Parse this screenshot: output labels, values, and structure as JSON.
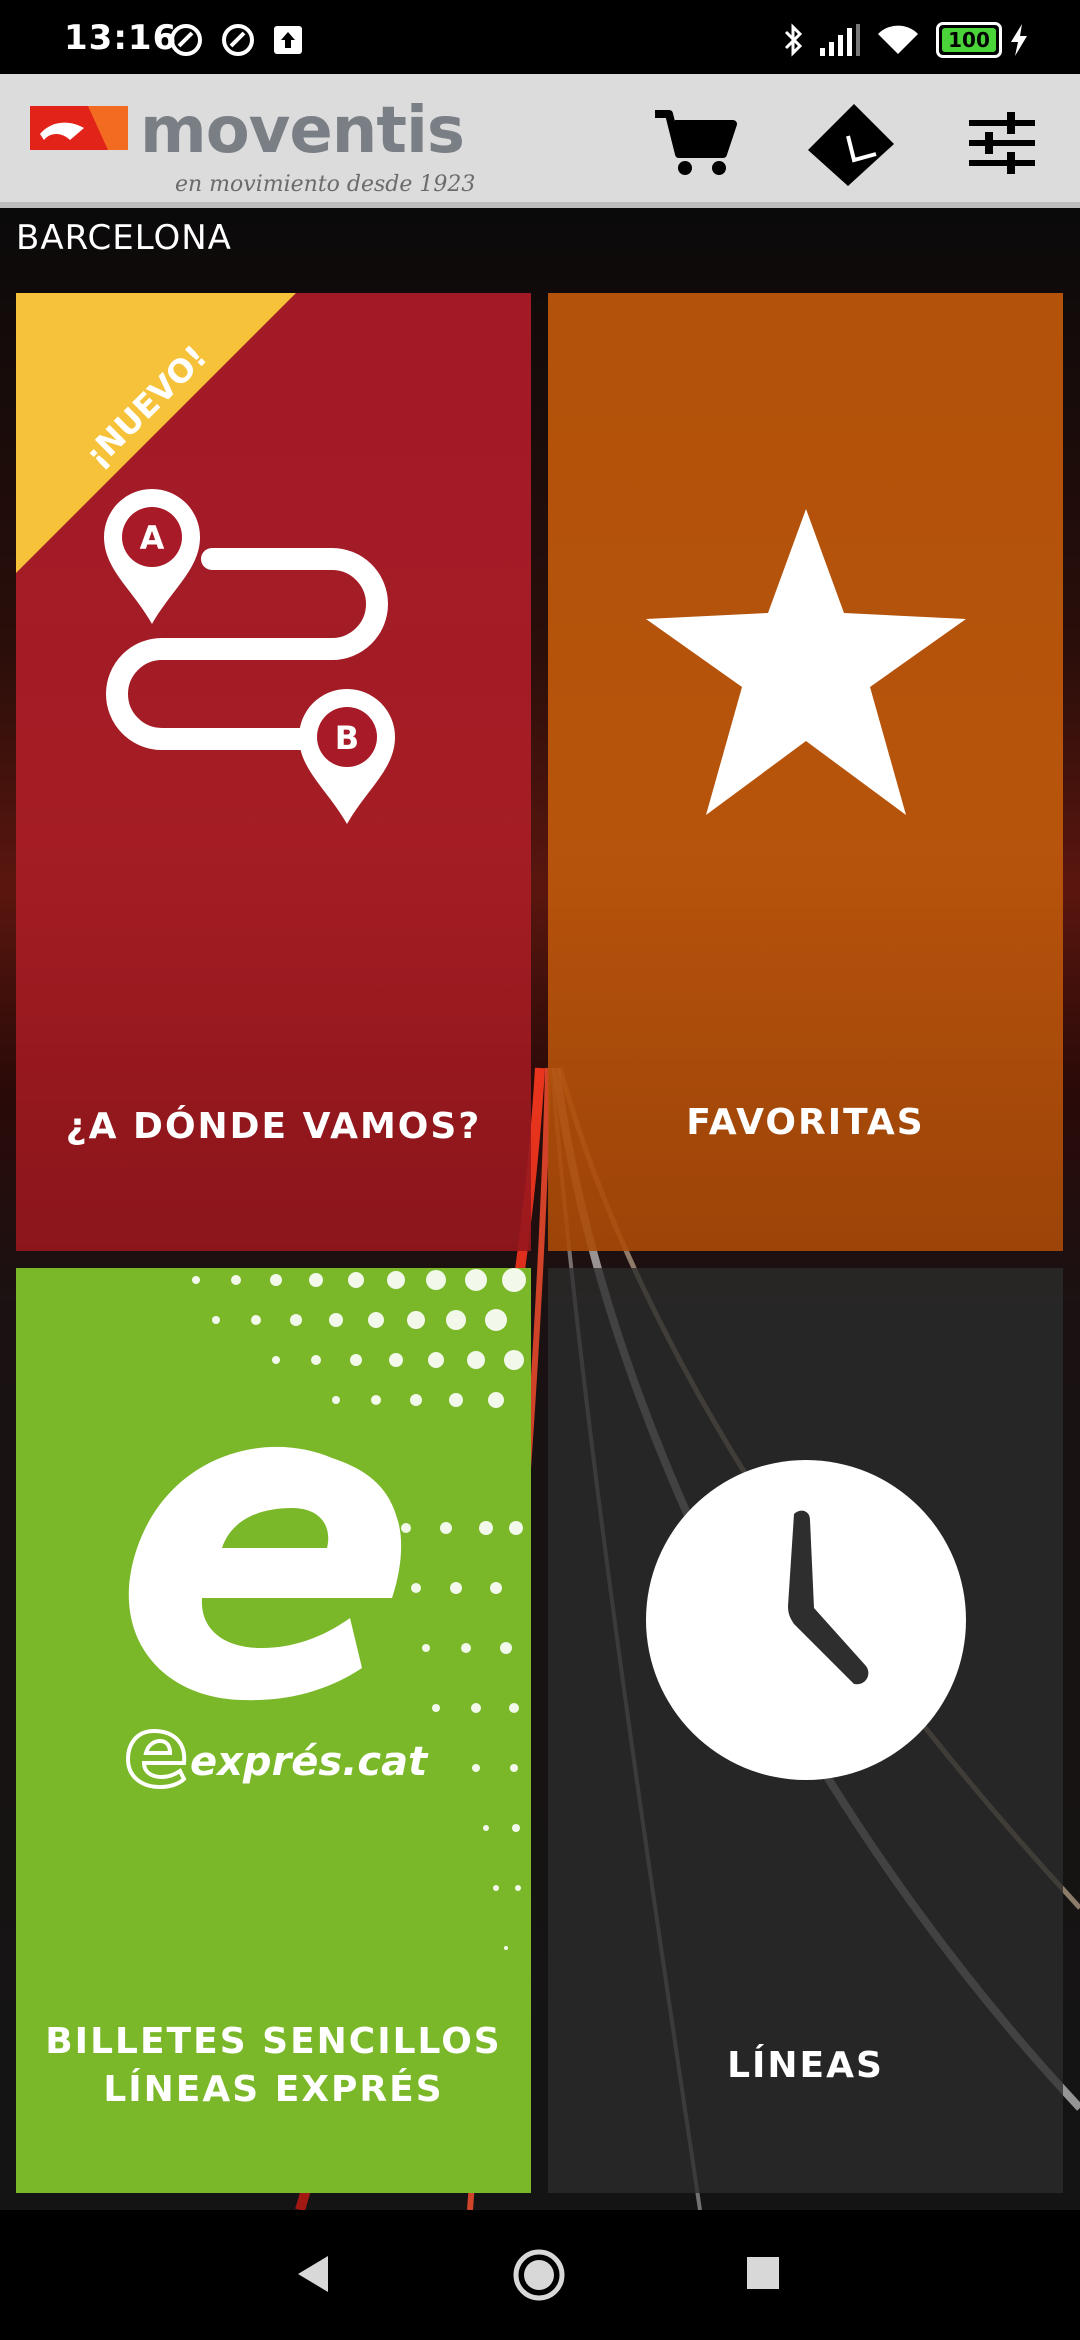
{
  "status_bar": {
    "time": "13:16",
    "battery": "100"
  },
  "header": {
    "brand": "moventis",
    "tagline": "en movimiento desde 1923",
    "icons": [
      "cart-icon",
      "ticket-icon",
      "settings-sliders-icon"
    ]
  },
  "location": "BARCELONA",
  "tiles": [
    {
      "id": "route",
      "label": "¿A DÓNDE VAMOS?",
      "badge": "¡NUEVO!",
      "icon": "route-a-b-icon",
      "color": "#a81a28"
    },
    {
      "id": "favorites",
      "label": "FAVORITAS",
      "icon": "star-icon",
      "color": "#b8540a"
    },
    {
      "id": "express",
      "label_line1": "BILLETES SENCILLOS",
      "label_line2": "LÍNEAS EXPRÉS",
      "logo_text": "exprés.cat",
      "icon": "express-e-icon",
      "color": "#7ab829"
    },
    {
      "id": "lines",
      "label": "LÍNEAS",
      "icon": "clock-icon",
      "color": "#2c2c2c"
    }
  ],
  "nav": [
    "back-icon",
    "home-icon",
    "recents-icon"
  ]
}
